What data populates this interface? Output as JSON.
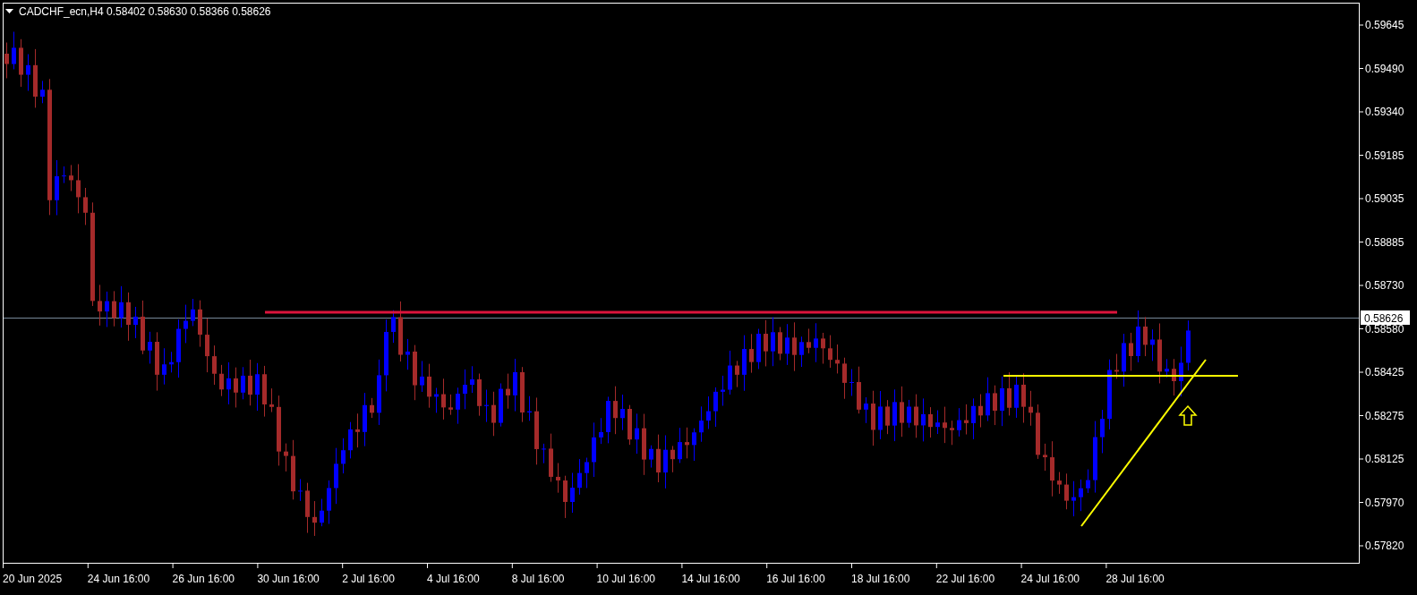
{
  "header": {
    "symbol": "CADCHF_ecn,H4",
    "quotes": [
      "0.58402",
      "0.58630",
      "0.58366",
      "0.58626"
    ]
  },
  "price_axis": {
    "labels": [
      "0.59645",
      "0.59490",
      "0.59340",
      "0.59185",
      "0.59035",
      "0.58885",
      "0.58730",
      "0.58580",
      "0.58425",
      "0.58275",
      "0.58125",
      "0.57970",
      "0.57820"
    ],
    "current_price": "0.58626"
  },
  "time_axis": {
    "labels": [
      "20 Jun 2025",
      "24 Jun 16:00",
      "26 Jun 16:00",
      "30 Jun 16:00",
      "2 Jul 16:00",
      "4 Jul 16:00",
      "8 Jul 16:00",
      "10 Jul 16:00",
      "14 Jul 16:00",
      "16 Jul 16:00",
      "18 Jul 16:00",
      "22 Jul 16:00",
      "24 Jul 16:00",
      "28 Jul 16:00"
    ]
  }
}
